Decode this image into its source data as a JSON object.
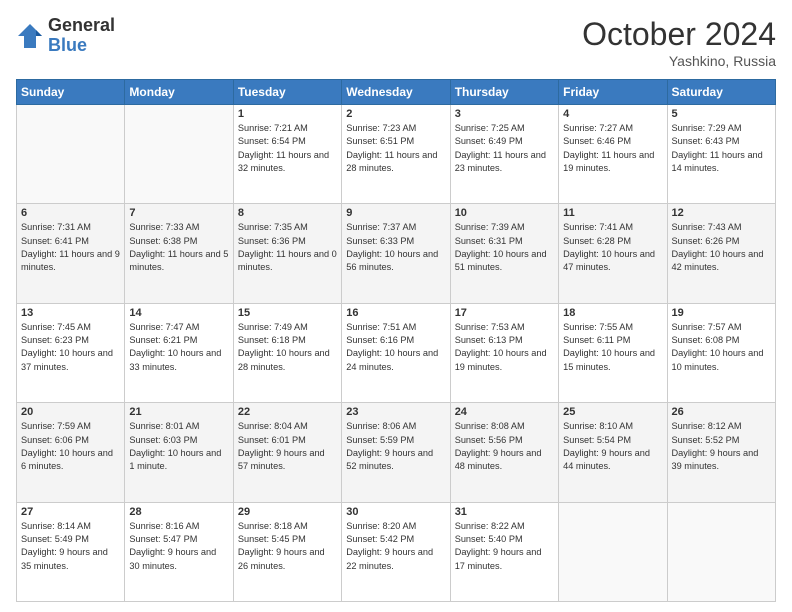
{
  "header": {
    "logo_general": "General",
    "logo_blue": "Blue",
    "month": "October 2024",
    "location": "Yashkino, Russia"
  },
  "weekdays": [
    "Sunday",
    "Monday",
    "Tuesday",
    "Wednesday",
    "Thursday",
    "Friday",
    "Saturday"
  ],
  "rows": [
    [
      {
        "day": "",
        "info": ""
      },
      {
        "day": "",
        "info": ""
      },
      {
        "day": "1",
        "info": "Sunrise: 7:21 AM\nSunset: 6:54 PM\nDaylight: 11 hours\nand 32 minutes."
      },
      {
        "day": "2",
        "info": "Sunrise: 7:23 AM\nSunset: 6:51 PM\nDaylight: 11 hours\nand 28 minutes."
      },
      {
        "day": "3",
        "info": "Sunrise: 7:25 AM\nSunset: 6:49 PM\nDaylight: 11 hours\nand 23 minutes."
      },
      {
        "day": "4",
        "info": "Sunrise: 7:27 AM\nSunset: 6:46 PM\nDaylight: 11 hours\nand 19 minutes."
      },
      {
        "day": "5",
        "info": "Sunrise: 7:29 AM\nSunset: 6:43 PM\nDaylight: 11 hours\nand 14 minutes."
      }
    ],
    [
      {
        "day": "6",
        "info": "Sunrise: 7:31 AM\nSunset: 6:41 PM\nDaylight: 11 hours\nand 9 minutes."
      },
      {
        "day": "7",
        "info": "Sunrise: 7:33 AM\nSunset: 6:38 PM\nDaylight: 11 hours\nand 5 minutes."
      },
      {
        "day": "8",
        "info": "Sunrise: 7:35 AM\nSunset: 6:36 PM\nDaylight: 11 hours\nand 0 minutes."
      },
      {
        "day": "9",
        "info": "Sunrise: 7:37 AM\nSunset: 6:33 PM\nDaylight: 10 hours\nand 56 minutes."
      },
      {
        "day": "10",
        "info": "Sunrise: 7:39 AM\nSunset: 6:31 PM\nDaylight: 10 hours\nand 51 minutes."
      },
      {
        "day": "11",
        "info": "Sunrise: 7:41 AM\nSunset: 6:28 PM\nDaylight: 10 hours\nand 47 minutes."
      },
      {
        "day": "12",
        "info": "Sunrise: 7:43 AM\nSunset: 6:26 PM\nDaylight: 10 hours\nand 42 minutes."
      }
    ],
    [
      {
        "day": "13",
        "info": "Sunrise: 7:45 AM\nSunset: 6:23 PM\nDaylight: 10 hours\nand 37 minutes."
      },
      {
        "day": "14",
        "info": "Sunrise: 7:47 AM\nSunset: 6:21 PM\nDaylight: 10 hours\nand 33 minutes."
      },
      {
        "day": "15",
        "info": "Sunrise: 7:49 AM\nSunset: 6:18 PM\nDaylight: 10 hours\nand 28 minutes."
      },
      {
        "day": "16",
        "info": "Sunrise: 7:51 AM\nSunset: 6:16 PM\nDaylight: 10 hours\nand 24 minutes."
      },
      {
        "day": "17",
        "info": "Sunrise: 7:53 AM\nSunset: 6:13 PM\nDaylight: 10 hours\nand 19 minutes."
      },
      {
        "day": "18",
        "info": "Sunrise: 7:55 AM\nSunset: 6:11 PM\nDaylight: 10 hours\nand 15 minutes."
      },
      {
        "day": "19",
        "info": "Sunrise: 7:57 AM\nSunset: 6:08 PM\nDaylight: 10 hours\nand 10 minutes."
      }
    ],
    [
      {
        "day": "20",
        "info": "Sunrise: 7:59 AM\nSunset: 6:06 PM\nDaylight: 10 hours\nand 6 minutes."
      },
      {
        "day": "21",
        "info": "Sunrise: 8:01 AM\nSunset: 6:03 PM\nDaylight: 10 hours\nand 1 minute."
      },
      {
        "day": "22",
        "info": "Sunrise: 8:04 AM\nSunset: 6:01 PM\nDaylight: 9 hours\nand 57 minutes."
      },
      {
        "day": "23",
        "info": "Sunrise: 8:06 AM\nSunset: 5:59 PM\nDaylight: 9 hours\nand 52 minutes."
      },
      {
        "day": "24",
        "info": "Sunrise: 8:08 AM\nSunset: 5:56 PM\nDaylight: 9 hours\nand 48 minutes."
      },
      {
        "day": "25",
        "info": "Sunrise: 8:10 AM\nSunset: 5:54 PM\nDaylight: 9 hours\nand 44 minutes."
      },
      {
        "day": "26",
        "info": "Sunrise: 8:12 AM\nSunset: 5:52 PM\nDaylight: 9 hours\nand 39 minutes."
      }
    ],
    [
      {
        "day": "27",
        "info": "Sunrise: 8:14 AM\nSunset: 5:49 PM\nDaylight: 9 hours\nand 35 minutes."
      },
      {
        "day": "28",
        "info": "Sunrise: 8:16 AM\nSunset: 5:47 PM\nDaylight: 9 hours\nand 30 minutes."
      },
      {
        "day": "29",
        "info": "Sunrise: 8:18 AM\nSunset: 5:45 PM\nDaylight: 9 hours\nand 26 minutes."
      },
      {
        "day": "30",
        "info": "Sunrise: 8:20 AM\nSunset: 5:42 PM\nDaylight: 9 hours\nand 22 minutes."
      },
      {
        "day": "31",
        "info": "Sunrise: 8:22 AM\nSunset: 5:40 PM\nDaylight: 9 hours\nand 17 minutes."
      },
      {
        "day": "",
        "info": ""
      },
      {
        "day": "",
        "info": ""
      }
    ]
  ]
}
